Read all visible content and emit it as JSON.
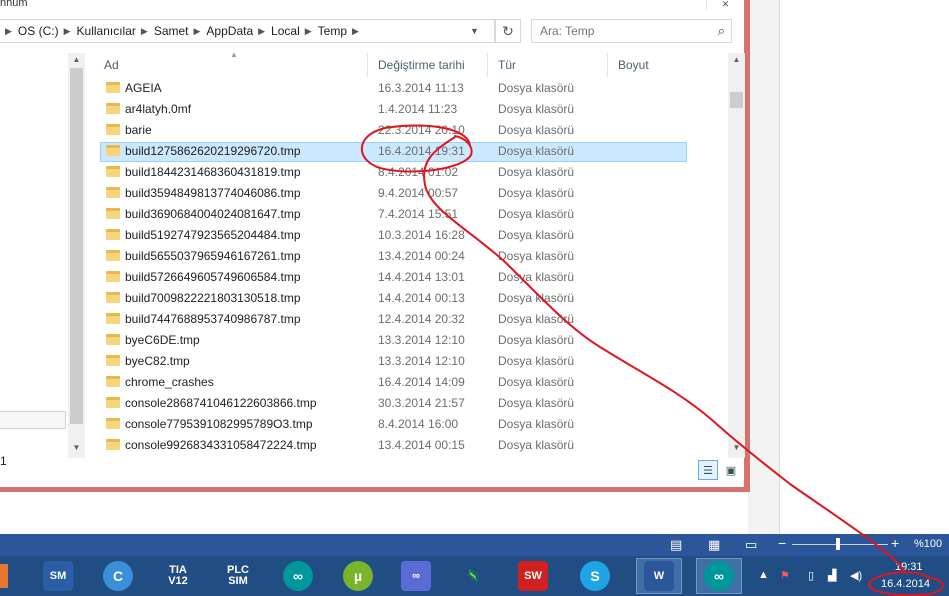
{
  "window": {
    "title_fragment": "nhum",
    "close_glyph": "✕"
  },
  "address_bar": {
    "crumbs": [
      "OS (C:)",
      "Kullanıcılar",
      "Samet",
      "AppData",
      "Local",
      "Temp"
    ]
  },
  "search": {
    "placeholder": "Ara: Temp"
  },
  "columns": {
    "name": "Ad",
    "date": "Değiştirme tarihi",
    "type": "Tür",
    "size": "Boyut"
  },
  "nav_pane": {
    "fragment_text": "1"
  },
  "files": [
    {
      "name": "AGEIA",
      "date": "16.3.2014 11:13",
      "type": "Dosya klasörü"
    },
    {
      "name": "ar4latyh.0mf",
      "date": "1.4.2014 11:23",
      "type": "Dosya klasörü"
    },
    {
      "name": "barie",
      "date": "22.3.2014 20:10",
      "type": "Dosya klasörü"
    },
    {
      "name": "build1275862620219296720.tmp",
      "date": "16.4.2014 19:31",
      "type": "Dosya klasörü",
      "selected": true
    },
    {
      "name": "build1844231468360431819.tmp",
      "date": "8.4.2014 01:02",
      "type": "Dosya klasörü"
    },
    {
      "name": "build3594849813774046086.tmp",
      "date": "9.4.2014 00:57",
      "type": "Dosya klasörü"
    },
    {
      "name": "build3690684004024081647.tmp",
      "date": "7.4.2014 15:51",
      "type": "Dosya klasörü"
    },
    {
      "name": "build5192747923565204484.tmp",
      "date": "10.3.2014 16:28",
      "type": "Dosya klasörü"
    },
    {
      "name": "build5655037965946167261.tmp",
      "date": "13.4.2014 00:24",
      "type": "Dosya klasörü"
    },
    {
      "name": "build5726649605749606584.tmp",
      "date": "14.4.2014 13:01",
      "type": "Dosya klasörü"
    },
    {
      "name": "build7009822221803130518.tmp",
      "date": "14.4.2014 00:13",
      "type": "Dosya klasörü"
    },
    {
      "name": "build7447688953740986787.tmp",
      "date": "12.4.2014 20:32",
      "type": "Dosya klasörü"
    },
    {
      "name": "byeC6DE.tmp",
      "date": "13.3.2014 12:10",
      "type": "Dosya klasörü"
    },
    {
      "name": "byeC82.tmp",
      "date": "13.3.2014 12:10",
      "type": "Dosya klasörü"
    },
    {
      "name": "chrome_crashes",
      "date": "16.4.2014 14:09",
      "type": "Dosya klasörü"
    },
    {
      "name": "console2868741046122603866.tmp",
      "date": "30.3.2014 21:57",
      "type": "Dosya klasörü"
    },
    {
      "name": "console7795391082995789O3.tmp",
      "date": "8.4.2014 16:00",
      "type": "Dosya klasörü"
    },
    {
      "name": "console9926834331058472224.tmp",
      "date": "13.4.2014 00:15",
      "type": "Dosya klasörü"
    }
  ],
  "status_bar": {
    "zoom_level": "%100",
    "zoom_minus": "−",
    "zoom_plus": "+"
  },
  "taskbar": {
    "apps": [
      {
        "name": "simatic-manager",
        "label": "SM",
        "color": "#2a5fa8"
      },
      {
        "name": "ccleaner-like",
        "label": "C",
        "color": "#3a8fd8"
      },
      {
        "name": "tia-portal",
        "label": "TIA\nV12",
        "color": "#1f4d84"
      },
      {
        "name": "plcsim",
        "label": "PLC\nSIM",
        "color": "#1f4d84"
      },
      {
        "name": "arduino-1",
        "label": "∞",
        "color": "#00979c"
      },
      {
        "name": "utorrent",
        "label": "µ",
        "color": "#78b52a"
      },
      {
        "name": "infinity-app",
        "label": "∞",
        "color": "#5b6bd6"
      },
      {
        "name": "lizard-app",
        "label": "🦎",
        "color": "#1f4d84"
      },
      {
        "name": "solidworks",
        "label": "SW",
        "color": "#d02020"
      },
      {
        "name": "skype",
        "label": "S",
        "color": "#1fa4e6"
      },
      {
        "name": "word",
        "label": "W",
        "color": "#2b579a"
      },
      {
        "name": "arduino-2",
        "label": "∞",
        "color": "#00979c"
      }
    ],
    "clock_time": "19:31",
    "clock_date": "16.4.2014"
  },
  "annotation": {
    "color": "#e0161e"
  }
}
